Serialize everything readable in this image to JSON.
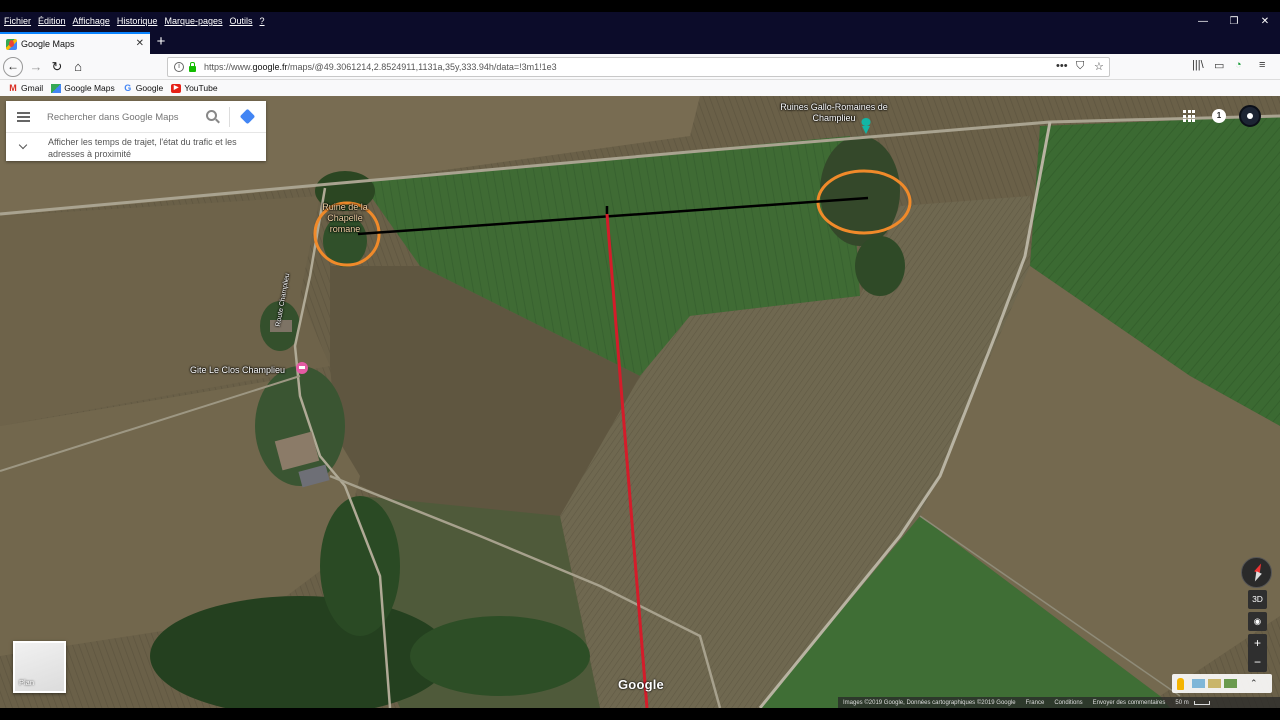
{
  "browser": {
    "menus": [
      "Fichier",
      "Édition",
      "Affichage",
      "Historique",
      "Marque-pages",
      "Outils",
      "?"
    ],
    "tab_title": "Google Maps",
    "url_prefix": "https://www.",
    "url_host": "google.fr",
    "url_path": "/maps/@49.3061214,2.8524911,1131a,35y,333.94h/data=!3m1!1e3",
    "bookmarks": [
      "Gmail",
      "Google Maps",
      "Google",
      "YouTube"
    ]
  },
  "maps": {
    "search_placeholder": "Rechercher dans Google Maps",
    "traffic_text": "Afficher les temps de trajet, l'état du trafic et les adresses à proximité",
    "notification_count": "1",
    "plan_label": "Plan",
    "tilt_label": "3D",
    "zoom_in": "+",
    "zoom_out": "−",
    "logo": "Google",
    "places": {
      "ruins": "Ruines Gallo-Romaines de Champlieu",
      "chapel": "Ruine de la Chapelle romane",
      "gite": "Gite Le Clos Champlieu",
      "road": "Route Champlieu"
    },
    "footer": {
      "attribution": "Images ©2019 Google, Données cartographiques ©2019 Google",
      "country": "France",
      "conditions": "Conditions",
      "feedback": "Envoyer des commentaires",
      "scale": "50 m"
    }
  },
  "colors": {
    "annotation_circle": "#f08a2a",
    "black_line": "#000000",
    "red_line": "#d41c2a",
    "chrome_dark": "#0c0c2a"
  }
}
